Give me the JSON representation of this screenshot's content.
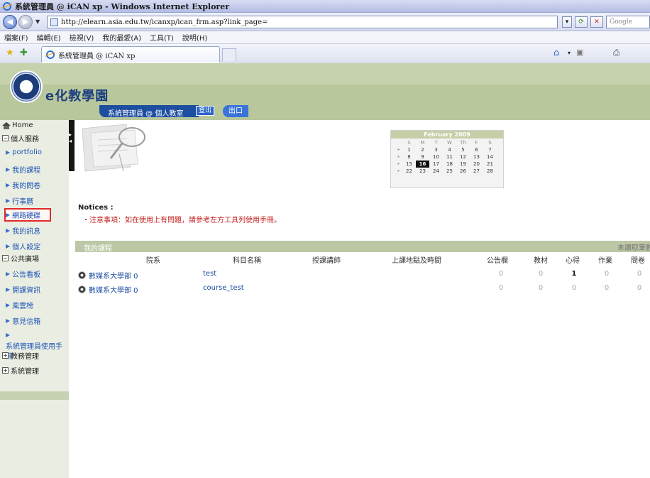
{
  "browser": {
    "window_title": "系統管理員 @ iCAN xp - Windows Internet Explorer",
    "url": "http://elearn.asia.edu.tw/icanxp/ican_frm.asp?link_page=",
    "search_placeholder": "Google",
    "menu": [
      "檔案(F)",
      "編輯(E)",
      "檢視(V)",
      "我的最愛(A)",
      "工具(T)",
      "說明(H)"
    ],
    "tab_title": "系統管理員 @ iCAN xp"
  },
  "header": {
    "logo_text": "e化教學園",
    "user_label": "系統管理員 @ 個人教室",
    "logout_label": "登出",
    "exit_label": "出口"
  },
  "sidebar": {
    "home": "Home",
    "personal_services": "個人服務",
    "personal_items": [
      "portfolio",
      "我的課程",
      "我的問卷",
      "行事曆",
      "網路硬碟",
      "我的訊息",
      "個人設定"
    ],
    "public_square": "公共廣場",
    "public_items": [
      "公告看板",
      "開課資訊",
      "風雲榜",
      "意見信箱",
      "系統管理員使用手冊"
    ],
    "academic_admin": "教務管理",
    "system_admin": "系統管理"
  },
  "calendar": {
    "title": "February 2009",
    "weekdays": [
      "S",
      "M",
      "T",
      "W",
      "Th",
      "F",
      "S"
    ],
    "weeks": [
      [
        "1",
        "2",
        "3",
        "4",
        "5",
        "6",
        "7"
      ],
      [
        "8",
        "9",
        "10",
        "11",
        "12",
        "13",
        "14"
      ],
      [
        "15",
        "16",
        "17",
        "18",
        "19",
        "20",
        "21"
      ],
      [
        "22",
        "23",
        "24",
        "25",
        "26",
        "27",
        "28"
      ]
    ],
    "today": "16"
  },
  "notices": {
    "label": "Notices :",
    "text": "・注意事項：如在使用上有問題，請參考左方工具列使用手冊。"
  },
  "courses": {
    "section_title": "我的課程",
    "unread_label": "未讀取筆數",
    "columns": [
      "院系",
      "科目名稱",
      "授課講師",
      "上課地點及時間",
      "公告欄",
      "教材",
      "心得",
      "作業",
      "問卷"
    ],
    "rows": [
      {
        "dept": "數媒系大學部 0",
        "course": "test",
        "teacher": "",
        "location": "",
        "announcements": "0",
        "materials": "0",
        "reflections": "1",
        "homework": "0",
        "surveys": "0"
      },
      {
        "dept": "數媒系大學部 0",
        "course": "course_test",
        "teacher": "",
        "location": "",
        "announcements": "0",
        "materials": "0",
        "reflections": "0",
        "homework": "0",
        "surveys": "0"
      }
    ]
  }
}
